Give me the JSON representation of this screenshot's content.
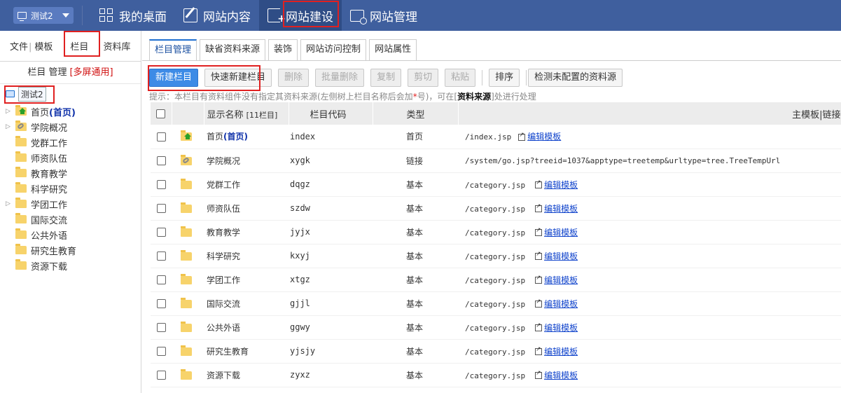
{
  "topbar": {
    "site_selector": "测试2",
    "nav": [
      {
        "label": "我的桌面",
        "icon": "desktop-icon"
      },
      {
        "label": "网站内容",
        "icon": "edit-icon"
      },
      {
        "label": "网站建设",
        "icon": "build-icon",
        "active": true
      },
      {
        "label": "网站管理",
        "icon": "manage-icon"
      }
    ]
  },
  "left": {
    "tabs": [
      "文件",
      "模板",
      "栏目",
      "资料库"
    ],
    "header": "栏目 管理",
    "header_tag": "[多屏通用]",
    "root": "测试2",
    "tree": [
      {
        "label": "首页",
        "tag": "(首页)",
        "expandable": true,
        "icon": "home-folder-icon"
      },
      {
        "label": "学院概况",
        "expandable": true,
        "icon": "link-folder-icon"
      },
      {
        "label": "党群工作",
        "expandable": false,
        "icon": "folder-icon"
      },
      {
        "label": "师资队伍",
        "expandable": false,
        "icon": "folder-icon"
      },
      {
        "label": "教育教学",
        "expandable": false,
        "icon": "folder-icon"
      },
      {
        "label": "科学研究",
        "expandable": false,
        "icon": "folder-icon"
      },
      {
        "label": "学团工作",
        "expandable": true,
        "icon": "folder-icon"
      },
      {
        "label": "国际交流",
        "expandable": false,
        "icon": "folder-icon"
      },
      {
        "label": "公共外语",
        "expandable": false,
        "icon": "folder-icon"
      },
      {
        "label": "研究生教育",
        "expandable": false,
        "icon": "folder-icon"
      },
      {
        "label": "资源下载",
        "expandable": false,
        "icon": "folder-icon"
      }
    ]
  },
  "main": {
    "tabs": [
      "栏目管理",
      "缺省资料来源",
      "装饰",
      "网站访问控制",
      "网站属性"
    ],
    "toolbar": {
      "new": "新建栏目",
      "quick_new": "快速新建栏目",
      "delete": "删除",
      "batch_delete": "批量删除",
      "copy": "复制",
      "cut": "剪切",
      "paste": "粘贴",
      "sort": "排序",
      "detect": "检测未配置的资料源"
    },
    "tip_pre": "提示：本栏目有资料组件没有指定其资料来源(左侧树上栏目名称后会加",
    "tip_star": "*",
    "tip_mid": "号)，可在[",
    "tip_bold": "资料来源",
    "tip_post": "]处进行处理",
    "columns": {
      "name": "显示名称",
      "count": "[11栏目]",
      "code": "栏目代码",
      "type": "类型",
      "template": "主模板|链接"
    },
    "edit_label": "编辑模板",
    "rows": [
      {
        "name": "首页",
        "tag": "(首页)",
        "code": "index",
        "type": "首页",
        "template": "/index.jsp",
        "edit": true,
        "icon": "home-folder-icon"
      },
      {
        "name": "学院概况",
        "code": "xygk",
        "type": "链接",
        "template": "/system/go.jsp?treeid=1037&apptype=treetemp&urltype=tree.TreeTempUrl",
        "edit": false,
        "icon": "link-folder-icon"
      },
      {
        "name": "党群工作",
        "code": "dqgz",
        "type": "基本",
        "template": "/category.jsp",
        "edit": true,
        "icon": "folder-icon"
      },
      {
        "name": "师资队伍",
        "code": "szdw",
        "type": "基本",
        "template": "/category.jsp",
        "edit": true,
        "icon": "folder-icon"
      },
      {
        "name": "教育教学",
        "code": "jyjx",
        "type": "基本",
        "template": "/category.jsp",
        "edit": true,
        "icon": "folder-icon"
      },
      {
        "name": "科学研究",
        "code": "kxyj",
        "type": "基本",
        "template": "/category.jsp",
        "edit": true,
        "icon": "folder-icon"
      },
      {
        "name": "学团工作",
        "code": "xtgz",
        "type": "基本",
        "template": "/category.jsp",
        "edit": true,
        "icon": "folder-icon"
      },
      {
        "name": "国际交流",
        "code": "gjjl",
        "type": "基本",
        "template": "/category.jsp",
        "edit": true,
        "icon": "folder-icon"
      },
      {
        "name": "公共外语",
        "code": "ggwy",
        "type": "基本",
        "template": "/category.jsp",
        "edit": true,
        "icon": "folder-icon"
      },
      {
        "name": "研究生教育",
        "code": "yjsjy",
        "type": "基本",
        "template": "/category.jsp",
        "edit": true,
        "icon": "folder-icon"
      },
      {
        "name": "资源下载",
        "code": "zyxz",
        "type": "基本",
        "template": "/category.jsp",
        "edit": true,
        "icon": "folder-icon"
      }
    ]
  }
}
